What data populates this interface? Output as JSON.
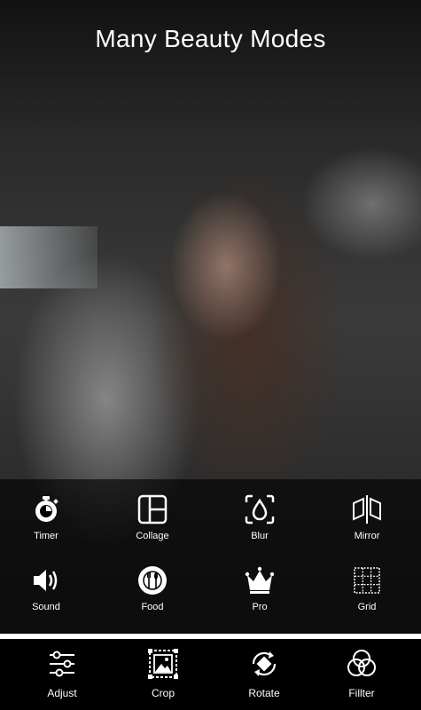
{
  "headline": "Many Beauty Modes",
  "modes": [
    {
      "label": "Timer",
      "icon": "timer-icon"
    },
    {
      "label": "Collage",
      "icon": "collage-icon"
    },
    {
      "label": "Blur",
      "icon": "blur-icon"
    },
    {
      "label": "Mirror",
      "icon": "mirror-icon"
    },
    {
      "label": "Sound",
      "icon": "sound-icon"
    },
    {
      "label": "Food",
      "icon": "food-icon"
    },
    {
      "label": "Pro",
      "icon": "crown-icon"
    },
    {
      "label": "Grid",
      "icon": "grid-icon"
    }
  ],
  "tools": [
    {
      "label": "Adjust",
      "icon": "sliders-icon"
    },
    {
      "label": "Crop",
      "icon": "crop-icon"
    },
    {
      "label": "Rotate",
      "icon": "rotate-icon"
    },
    {
      "label": "Fillter",
      "icon": "filter-icon"
    }
  ],
  "colors": {
    "panel": "#000000",
    "text": "#ffffff",
    "crown": "#ffffff"
  }
}
